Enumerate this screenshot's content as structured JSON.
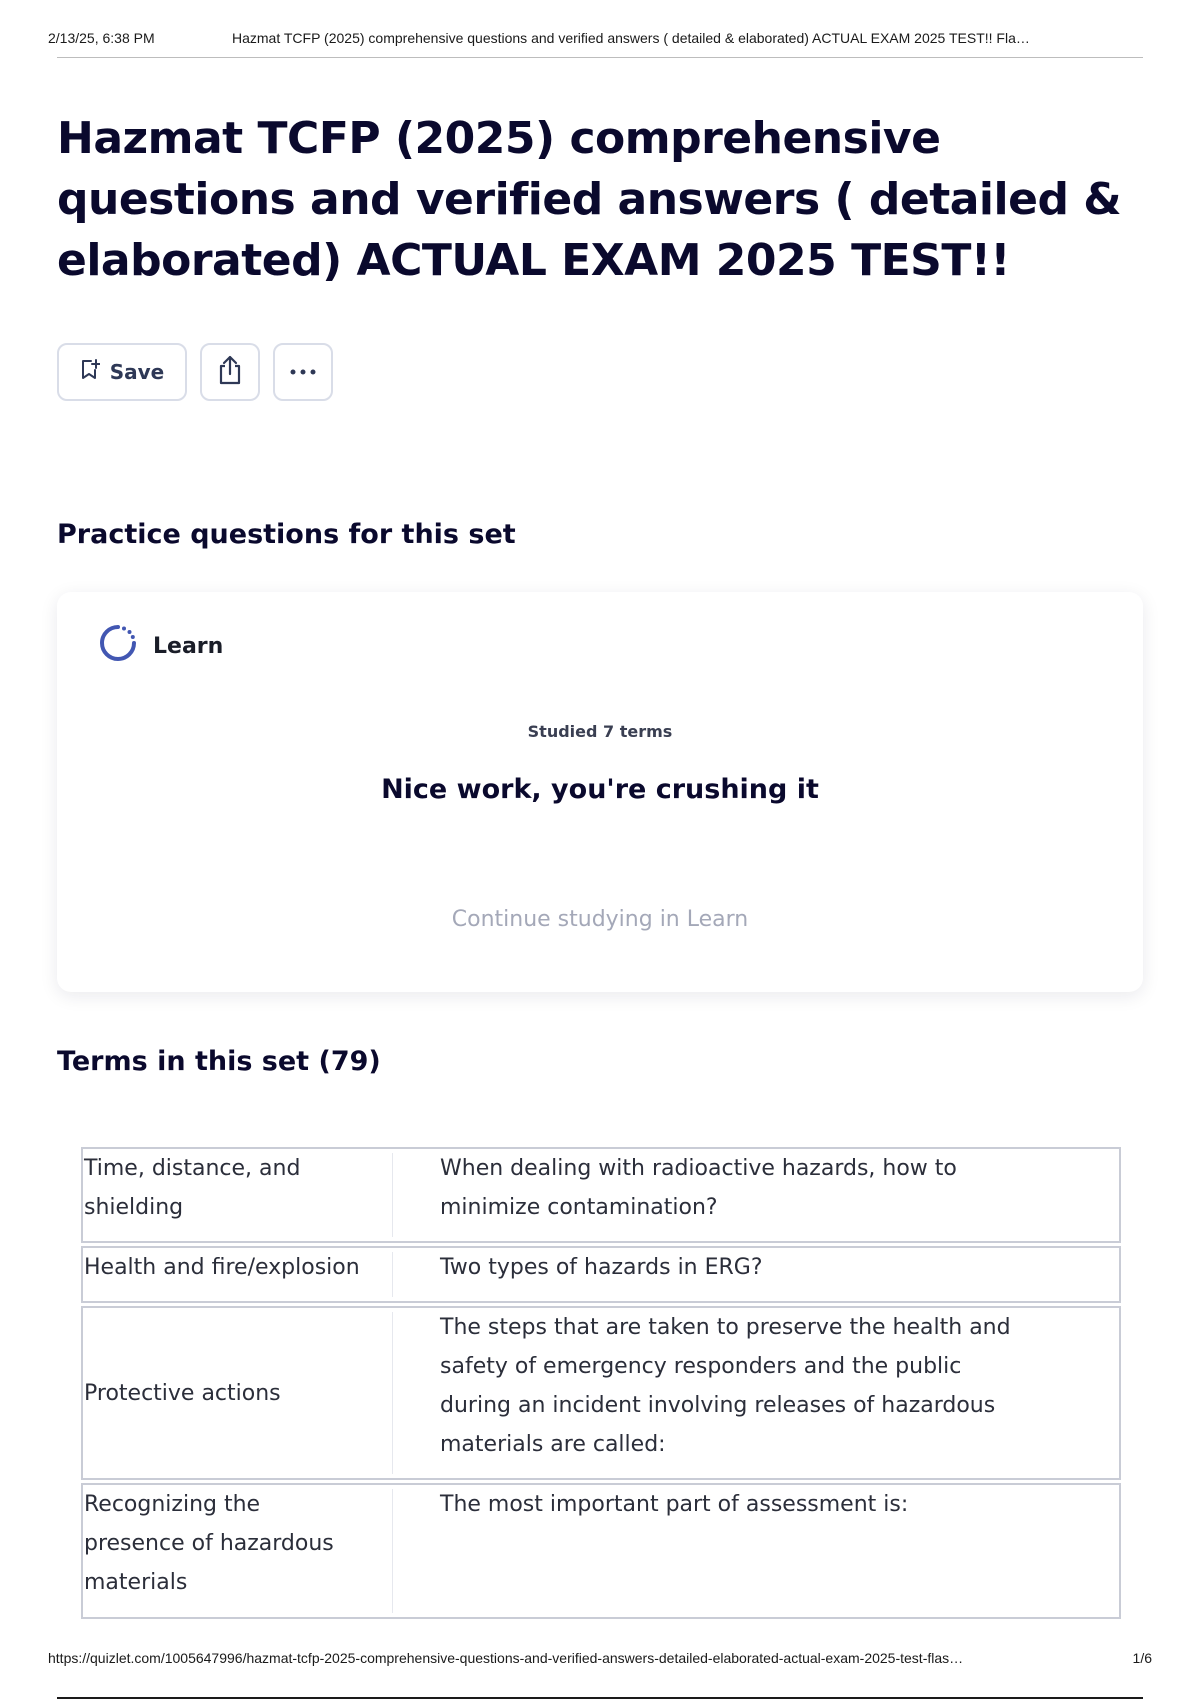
{
  "print_header": {
    "datetime": "2/13/25, 6:38 PM",
    "doc_title": "Hazmat TCFP (2025) comprehensive questions and verified answers ( detailed & elaborated) ACTUAL EXAM 2025 TEST!! Fla…"
  },
  "set": {
    "title": "Hazmat TCFP (2025) comprehensive questions and verified answers ( detailed & elaborated) ACTUAL EXAM 2025 TEST!!"
  },
  "actions": {
    "save_label": "Save",
    "icons": [
      "bookmark-add-icon",
      "share-icon",
      "more-icon"
    ]
  },
  "practice": {
    "heading": "Practice questions for this set",
    "mode_label": "Learn",
    "mode_icon": "learn-progress-icon",
    "studied_text": "Studied 7 terms",
    "message": "Nice work, you're crushing it",
    "continue_label": "Continue studying in Learn"
  },
  "terms": {
    "heading": "Terms in this set (79)",
    "rows": [
      {
        "term": [
          "Time, distance, and",
          "shielding"
        ],
        "definition": [
          "When dealing with radioactive hazards, how to",
          "minimize contamination?"
        ]
      },
      {
        "term": [
          "Health and fire/explosion"
        ],
        "definition": [
          "Two types of hazards in ERG?"
        ]
      },
      {
        "term": [
          "Protective actions"
        ],
        "definition": [
          "The steps that are taken to preserve the health and",
          "safety of emergency responders and the public",
          "during an incident involving releases of hazardous",
          "materials are called:"
        ]
      },
      {
        "term": [
          "Recognizing the",
          "presence of hazardous",
          "materials"
        ],
        "definition": [
          "The most important part of assessment is:"
        ]
      }
    ]
  },
  "print_footer": {
    "url": "https://quizlet.com/1005647996/hazmat-tcfp-2025-comprehensive-questions-and-verified-answers-detailed-elaborated-actual-exam-2025-test-flas…",
    "page": "1/6"
  },
  "colors": {
    "text_primary": "#0a092d",
    "button_border": "#d9dde8",
    "learn_accent": "#4257b2",
    "muted_text": "#a4a8b8"
  }
}
